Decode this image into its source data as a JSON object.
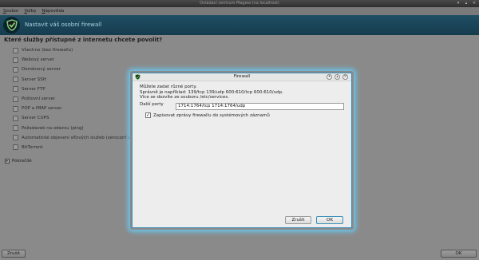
{
  "window": {
    "title": "Ovládací centrum Mageia  (na localhost)"
  },
  "menu": [
    "Soubor",
    "Volby",
    "Nápověda"
  ],
  "banner": {
    "heading": "Nastavit váš osobní firewall"
  },
  "main": {
    "question": "Které služby přístupné z internetu chcete povolit?",
    "services": [
      {
        "label": "Všechno (bez firewallu)",
        "checked": false
      },
      {
        "label": "Webový server",
        "checked": false
      },
      {
        "label": "Doménový server",
        "checked": false
      },
      {
        "label": "Server SSH",
        "checked": false
      },
      {
        "label": "Server FTP",
        "checked": false
      },
      {
        "label": "Poštovní server",
        "checked": false
      },
      {
        "label": "POP a IMAP server",
        "checked": false
      },
      {
        "label": "Server CUPS",
        "checked": false
      },
      {
        "label": "Požadavek na odezvu (ping)",
        "checked": false
      },
      {
        "label": "Automatické objevení síťových služeb (zeroconf a",
        "checked": false
      },
      {
        "label": "BitTorrent",
        "checked": false
      }
    ],
    "advanced": "Pokročilé"
  },
  "bottom": {
    "cancel": "Zrušit",
    "ok": "OK"
  },
  "dialog": {
    "title": "Firewall",
    "lines": [
      "Můžete zadat různé porty.",
      "Správně je například: 139/tcp 139/udp 600:610/tcp 600:610/udp.",
      "Více se dozvíte ze souboru /etc/services."
    ],
    "ports_label": "Další porty",
    "ports_value": "1714:1764/tcp 1714:1764/udp",
    "log_label": "Zapisovat zprávy firewallu do systémových záznamů",
    "log_checked": true,
    "cancel": "Zrušit",
    "ok": "OK"
  }
}
